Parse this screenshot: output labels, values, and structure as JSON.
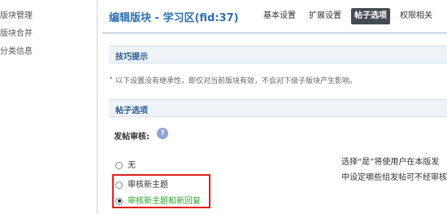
{
  "sidebar": {
    "items": [
      {
        "label": "版块管理"
      },
      {
        "label": "版块合并"
      },
      {
        "label": "分类信息"
      }
    ]
  },
  "header": {
    "title": "编辑版块 - 学习区(fid:37)",
    "tabs": [
      {
        "label": "基本设置",
        "active": false
      },
      {
        "label": "扩展设置",
        "active": false
      },
      {
        "label": "帖子选项",
        "active": true
      },
      {
        "label": "权限相关",
        "active": false
      }
    ]
  },
  "tips": {
    "title": "技巧提示",
    "text": "以下设置没有继承性，即仅对当前版块有效，不会对下级子版块产生影响。"
  },
  "post_options": {
    "title": "帖子选项",
    "review": {
      "label": "发帖审核:",
      "help_icon": "?",
      "options": [
        {
          "label": "无",
          "checked": false
        },
        {
          "label": "审核新主题",
          "checked": false
        },
        {
          "label": "审核新主题和新回复",
          "checked": true
        }
      ],
      "description_lines": [
        "选择“是”将使用户在本版发",
        "中设定哪些组发帖可不经审核"
      ]
    }
  },
  "colors": {
    "accent": "#2f6fb5",
    "highlight": "#e0201e",
    "selected_option": "#2aa52a"
  }
}
